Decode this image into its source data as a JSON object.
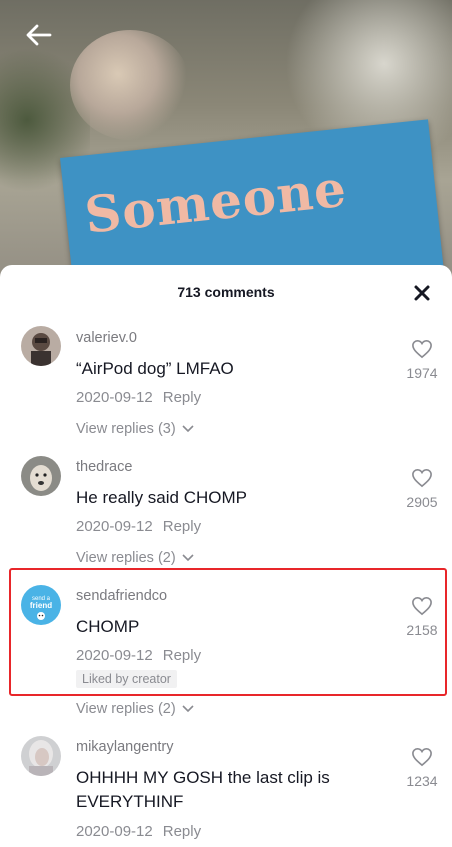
{
  "header": {
    "comment_count": "713 comments"
  },
  "video": {
    "sign_text": "Someone"
  },
  "comments": [
    {
      "username": "valeriev.0",
      "text": "“AirPod dog” LMFAO",
      "date": "2020-09-12",
      "reply_label": "Reply",
      "likes": "1974",
      "view_replies": "View replies (3)"
    },
    {
      "username": "thedrace",
      "text": "He really said CHOMP",
      "date": "2020-09-12",
      "reply_label": "Reply",
      "likes": "2905",
      "view_replies": "View replies (2)"
    },
    {
      "username": "sendafriendco",
      "text": "CHOMP",
      "date": "2020-09-12",
      "reply_label": "Reply",
      "likes": "2158",
      "badge": "Liked by creator",
      "view_replies": "View replies (2)",
      "avatar_text": "send a friend"
    },
    {
      "username": "mikaylangentry",
      "text": "OHHHH MY GOSH the last clip is EVERYTHINF",
      "date": "2020-09-12",
      "reply_label": "Reply",
      "likes": "1234"
    }
  ],
  "colors": {
    "highlight": "#e8262a",
    "avatar_sendafriend": "#4ab3e6"
  }
}
